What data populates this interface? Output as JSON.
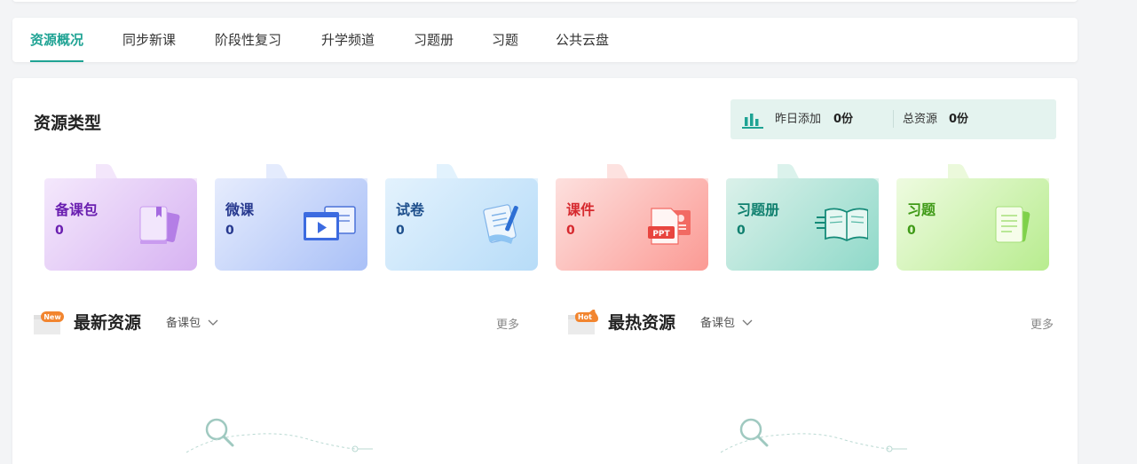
{
  "tabs": [
    {
      "label": "资源概况",
      "active": true
    },
    {
      "label": "同步新课",
      "active": false
    },
    {
      "label": "阶段性复习",
      "active": false
    },
    {
      "label": "升学频道",
      "active": false
    },
    {
      "label": "习题册",
      "active": false
    },
    {
      "label": "习题",
      "active": false
    },
    {
      "label": "公共云盘",
      "active": false
    }
  ],
  "resource_section": {
    "title": "资源类型",
    "stats": {
      "yesterday_label": "昨日添加",
      "yesterday_value": "0份",
      "total_label": "总资源",
      "total_value": "0份"
    },
    "cards": [
      {
        "name": "备课包",
        "count": "0",
        "color": "#6a1fb0",
        "icon": "lesson-package-icon"
      },
      {
        "name": "微课",
        "count": "0",
        "color": "#27398f",
        "icon": "micro-lesson-icon"
      },
      {
        "name": "试卷",
        "count": "0",
        "color": "#1e4f8c",
        "icon": "exam-paper-icon"
      },
      {
        "name": "课件",
        "count": "0",
        "color": "#d6292e",
        "icon": "ppt-courseware-icon"
      },
      {
        "name": "习题册",
        "count": "0",
        "color": "#10806f",
        "icon": "exercise-book-icon"
      },
      {
        "name": "习题",
        "count": "0",
        "color": "#3f9a17",
        "icon": "exercise-icon"
      }
    ]
  },
  "latest": {
    "badge": "New",
    "title": "最新资源",
    "select": "备课包",
    "more": "更多"
  },
  "hottest": {
    "badge": "Hot",
    "title": "最热资源",
    "select": "备课包",
    "more": "更多"
  },
  "colors": {
    "accent": "#1fa394",
    "stats_bg": "#e4f3ef"
  }
}
